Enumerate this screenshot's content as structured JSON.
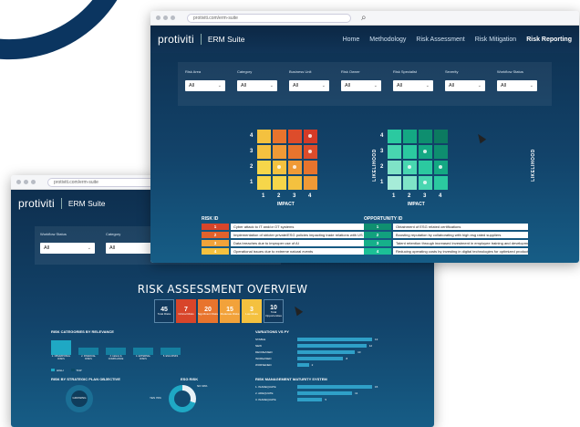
{
  "front": {
    "url": "protiviti.com/erm-suite",
    "logo": "protiviti",
    "suite": "ERM Suite",
    "menu": [
      "Home",
      "Methodology",
      "Risk Assessment",
      "Risk Mitigation",
      "Risk Reporting"
    ],
    "filters": [
      {
        "label": "Risk Area",
        "value": "All"
      },
      {
        "label": "Category",
        "value": "All"
      },
      {
        "label": "Business Unit",
        "value": "All"
      },
      {
        "label": "Risk Owner",
        "value": "All"
      },
      {
        "label": "Risk Specialist",
        "value": "All"
      },
      {
        "label": "Severity",
        "value": "All"
      },
      {
        "label": "Workflow Status",
        "value": "All"
      }
    ],
    "risk_matrix": {
      "ylabel": "LIKELIHOOD",
      "xlabel": "IMPACT",
      "ticks": [
        "1",
        "2",
        "3",
        "4"
      ]
    },
    "opp_matrix": {
      "ylabel": "LIKELIHOOD",
      "xlabel": "IMPACT",
      "ticks": [
        "1",
        "2",
        "3",
        "4"
      ]
    },
    "risk_list": {
      "heading": "RISK ID",
      "rows": [
        {
          "id": "1",
          "text": "Cyber attack to IT and/or OT systems",
          "color": "#d8452a"
        },
        {
          "id": "2",
          "text": "Implementation of stricter private/ESG policies impacting trade relations with US",
          "color": "#e2622c"
        },
        {
          "id": "3",
          "text": "Data breaches due to improper use of AI",
          "color": "#f1a33a"
        },
        {
          "id": "4",
          "text": "Operational issues due to extreme natural events",
          "color": "#f4c13f"
        }
      ]
    },
    "opp_list": {
      "heading": "OPPORTUNITY ID",
      "rows": [
        {
          "id": "1",
          "text": "Obtainment of ESG related certifications",
          "color": "#0f8f70"
        },
        {
          "id": "2",
          "text": "Boosting reputation by collaborating with high esg rated suppliers",
          "color": "#12a17e"
        },
        {
          "id": "3",
          "text": "Talent retention through increased investment in employee training and development",
          "color": "#16b08a"
        },
        {
          "id": "4",
          "text": "Reducing operating costs by investing in digital technologies for optimized production",
          "color": "#1cc096"
        }
      ]
    }
  },
  "back": {
    "url": "protiviti.com/erm-suite",
    "logo": "protiviti",
    "suite": "ERM Suite",
    "filters": [
      {
        "label": "Workflow Status",
        "value": "All"
      },
      {
        "label": "Category",
        "value": "All"
      }
    ],
    "title": "RISK ASSESSMENT OVERVIEW",
    "kpis": [
      {
        "value": "45",
        "label": "Total Risks",
        "color": "#123a5e"
      },
      {
        "value": "7",
        "label": "Critical Risks",
        "color": "#d8452a"
      },
      {
        "value": "20",
        "label": "Significant Risks",
        "color": "#e8742d"
      },
      {
        "value": "15",
        "label": "Moderate Risks",
        "color": "#f2a23a"
      },
      {
        "value": "3",
        "label": "Low Risks",
        "color": "#f4c13f"
      },
      {
        "value": "10",
        "label": "Total Opportunities",
        "color": "#123a5e"
      }
    ],
    "cat_heading": "RISK CATEGORIES BY RELEVANCE",
    "categories": [
      {
        "label": "1. OPERATIONAL RISKS",
        "value": 3
      },
      {
        "label": "2. FINANCIAL RISKS",
        "value": 1
      },
      {
        "label": "3. LEGAL & COMPLIANCE",
        "value": 1
      },
      {
        "label": "4. EXTERNAL RISKS",
        "value": 1
      },
      {
        "label": "5. ESG RISKS",
        "value": 1
      }
    ],
    "legend": [
      "HIGH",
      "TOP"
    ],
    "strategic_heading": "RISK BY STRATEGIC PLAN OBJECTIVE",
    "strategic_center": "GROWING",
    "esg_heading": "ESG RISK",
    "esg_yes": "YES 70%",
    "esg_no": "NO 30%",
    "variations_heading": "VARIATIONS VS PY",
    "variations": [
      {
        "label": "STABLE",
        "value": 13
      },
      {
        "label": "NEW",
        "value": 12
      },
      {
        "label": "DECREASED",
        "value": 10
      },
      {
        "label": "INCREASED",
        "value": 8
      },
      {
        "label": "WORSENED",
        "value": 2
      }
    ],
    "maturity_heading": "RISK MANAGEMENT MATURITY SYSTEM",
    "maturity": [
      {
        "label": "1. INADEQUATE",
        "value": 15
      },
      {
        "label": "2. ADEQUATE",
        "value": 11
      },
      {
        "label": "3. INADEQUATE",
        "value": 5
      }
    ]
  }
}
